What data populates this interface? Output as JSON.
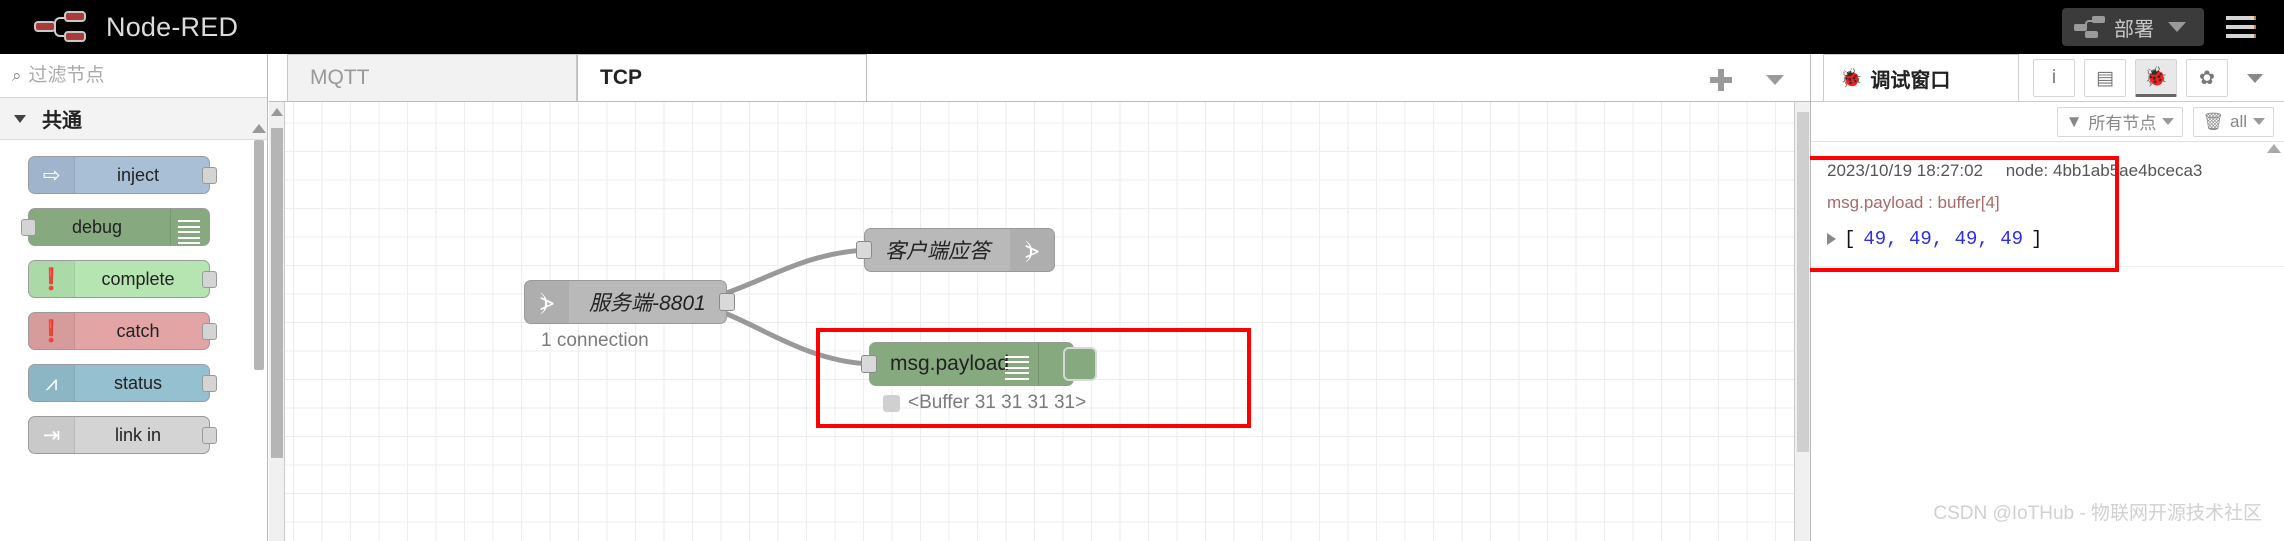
{
  "header": {
    "app_title": "Node-RED",
    "logo_icon": "node-red-logo-icon",
    "deploy_label": "部署",
    "deploy_icon": "deploy-nodes-icon",
    "menu_icon": "hamburger-menu-icon"
  },
  "palette": {
    "search_placeholder": "过滤节点",
    "search_value": "",
    "search_icon": "search-icon",
    "category": {
      "label": "共通",
      "caret_icon": "chevron-down-icon"
    },
    "nodes": [
      {
        "label": "inject",
        "icon": "arrow-right-icon",
        "color": "#a9bfd6"
      },
      {
        "label": "debug",
        "icon": "list-bars-icon",
        "color": "#87a980"
      },
      {
        "label": "complete",
        "icon": "exclamation-icon",
        "color": "#b5e5b0"
      },
      {
        "label": "catch",
        "icon": "exclamation-icon",
        "color": "#e2a4a4"
      },
      {
        "label": "status",
        "icon": "pulse-wave-icon",
        "color": "#94c0cf"
      },
      {
        "label": "link in",
        "icon": "link-in-icon",
        "color": "#d4d4d4"
      }
    ]
  },
  "tabbar": {
    "tabs": [
      {
        "label": "MQTT",
        "active": false
      },
      {
        "label": "TCP",
        "active": true
      }
    ],
    "add_icon": "plus-icon",
    "more_icon": "chevron-down-icon"
  },
  "flow": {
    "nodes": [
      {
        "label": "服务端-8801",
        "status": "1 connection",
        "icon": "tcp-wave-icon",
        "type": "tcp-in"
      },
      {
        "label": "客户端应答",
        "icon": "tcp-wave-icon",
        "type": "tcp-out"
      },
      {
        "label": "msg.payload",
        "status": "<Buffer 31 31 31 31>",
        "icon": "list-bars-icon",
        "type": "debug"
      }
    ],
    "selection_color": "#ff0000"
  },
  "sidebar": {
    "tab": {
      "label": "调试窗口",
      "icon": "bug-icon"
    },
    "icon_buttons": [
      {
        "name": "info-icon",
        "glyph": "i",
        "active": false
      },
      {
        "name": "book-icon",
        "glyph": "▤",
        "active": false
      },
      {
        "name": "bug-icon",
        "glyph": "🐞",
        "active": true
      },
      {
        "name": "gear-icon",
        "glyph": "✿",
        "active": false
      }
    ],
    "more_icon": "chevron-down-icon",
    "filter": {
      "label": "所有节点",
      "icon": "filter-icon",
      "caret_icon": "chevron-down-icon"
    },
    "clear": {
      "label": "all",
      "icon": "trash-icon",
      "caret_icon": "chevron-down-icon"
    },
    "messages": [
      {
        "timestamp": "2023/10/19 18:27:02",
        "node": "node: 4bb1ab5ae4bceca3",
        "topic": "msg.payload : buffer[4]",
        "open_bracket": "[",
        "values": "49, 49, 49, 49",
        "close_bracket": "]",
        "expander_icon": "expand-triangle-icon"
      }
    ],
    "highlight_color": "#ff0000"
  },
  "watermark": "CSDN @IoTHub - 物联网开源技术社区"
}
